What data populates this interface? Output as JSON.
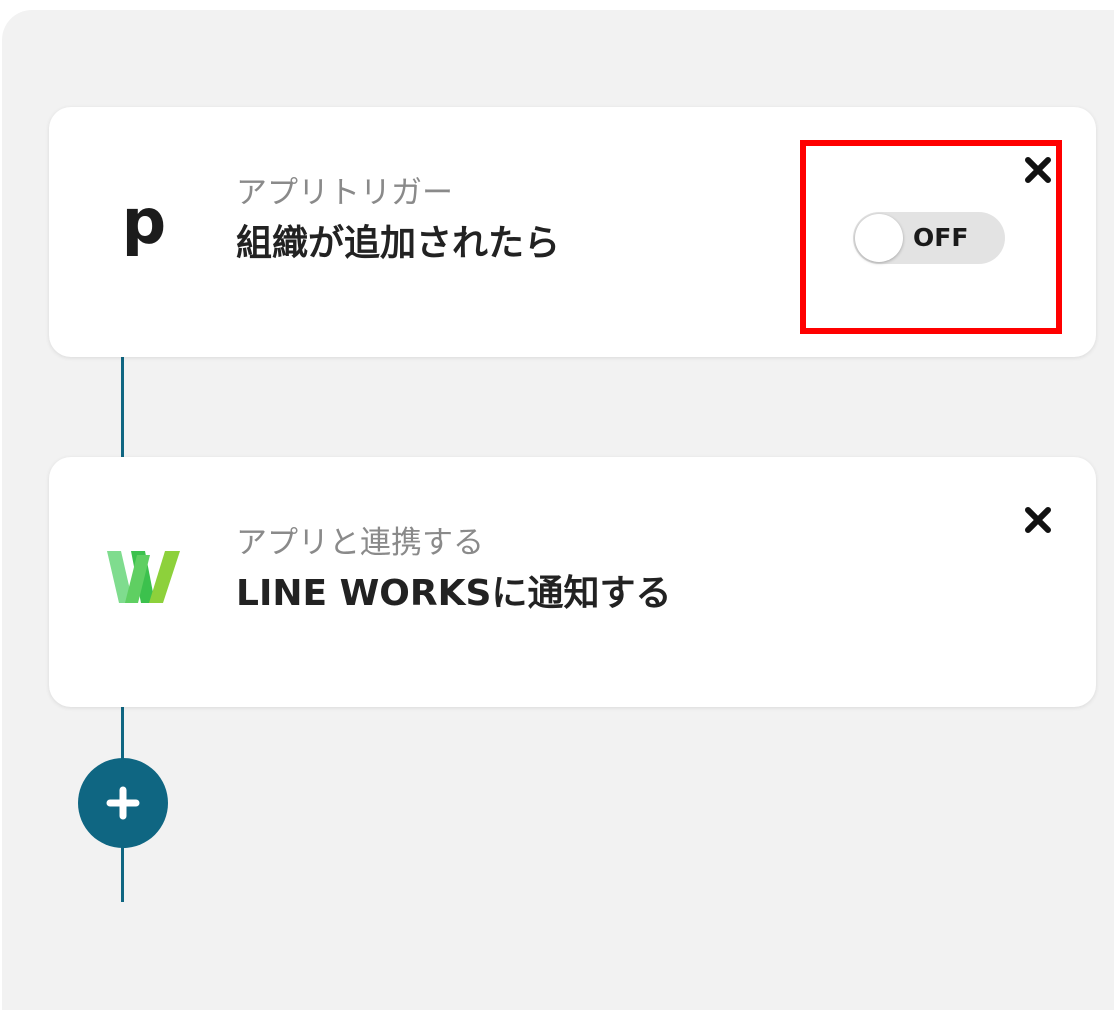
{
  "flow": {
    "steps": [
      {
        "app_icon": "pipedrive-p-logo",
        "logo_text": "p",
        "subtitle": "アプリトリガー",
        "title": "組織が追加されたら",
        "toggle": {
          "state": "off",
          "label": "OFF"
        },
        "close_icon": "close-icon"
      },
      {
        "app_icon": "line-works-w-logo",
        "subtitle": "アプリと連携する",
        "title": "LINE WORKSに通知する",
        "close_icon": "close-icon"
      }
    ],
    "add_step_icon": "plus-icon"
  },
  "colors": {
    "connector": "#0f6682",
    "add_button": "#0f6682",
    "highlight": "#ff0000",
    "panel_bg": "#f2f2f2",
    "line_works_green_light": "#7fdc8e",
    "line_works_green_mid": "#3cc14d",
    "line_works_green_dark": "#8dd13b"
  }
}
